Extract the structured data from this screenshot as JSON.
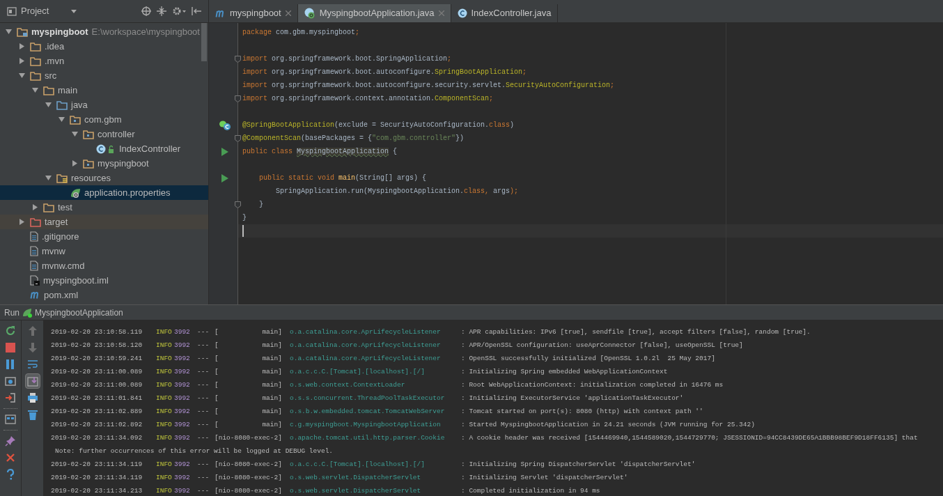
{
  "project_panel": {
    "title": "Project",
    "tree": [
      {
        "label": "myspingboot",
        "path": "E:\\workspace\\myspingboot",
        "kind": "module",
        "expanded": true,
        "selected": false,
        "children": [
          {
            "label": ".idea",
            "kind": "folder",
            "expanded": false,
            "selected": false
          },
          {
            "label": ".mvn",
            "kind": "folder",
            "expanded": false,
            "selected": false
          },
          {
            "label": "src",
            "kind": "folder",
            "expanded": true,
            "selected": false,
            "children": [
              {
                "label": "main",
                "kind": "folder",
                "expanded": true,
                "selected": false,
                "children": [
                  {
                    "label": "java",
                    "kind": "source-folder",
                    "expanded": true,
                    "selected": false,
                    "children": [
                      {
                        "label": "com.gbm",
                        "kind": "package",
                        "expanded": true,
                        "selected": false,
                        "children": [
                          {
                            "label": "controller",
                            "kind": "package",
                            "expanded": true,
                            "selected": false,
                            "children": [
                              {
                                "label": "IndexController",
                                "kind": "class",
                                "selected": false
                              }
                            ]
                          },
                          {
                            "label": "myspingboot",
                            "kind": "package",
                            "expanded": false,
                            "selected": false
                          }
                        ]
                      }
                    ]
                  },
                  {
                    "label": "resources",
                    "kind": "resources",
                    "expanded": true,
                    "selected": false,
                    "children": [
                      {
                        "label": "application.properties",
                        "kind": "spring-file",
                        "selected": true
                      }
                    ]
                  }
                ]
              },
              {
                "label": "test",
                "kind": "folder",
                "expanded": false,
                "selected": false
              }
            ]
          },
          {
            "label": "target",
            "kind": "excluded-folder",
            "expanded": false,
            "selected": false
          },
          {
            "label": ".gitignore",
            "kind": "file",
            "selected": false
          },
          {
            "label": "mvnw",
            "kind": "file",
            "selected": false
          },
          {
            "label": "mvnw.cmd",
            "kind": "file",
            "selected": false
          },
          {
            "label": "myspingboot.iml",
            "kind": "iml",
            "selected": false
          },
          {
            "label": "pom.xml",
            "kind": "maven",
            "selected": false
          }
        ]
      }
    ]
  },
  "tabs": [
    {
      "label": "myspingboot",
      "kind": "maven",
      "selected": false,
      "closable": true
    },
    {
      "label": "MyspingbootApplication.java",
      "kind": "spring",
      "selected": true,
      "closable": true
    },
    {
      "label": "IndexController.java",
      "kind": "class",
      "selected": false,
      "closable": false
    }
  ],
  "editor": {
    "lines": [
      {
        "kind": "plain",
        "tokens": [
          {
            "text": "package ",
            "kind": "keyword"
          },
          {
            "text": "com.gbm.myspingboot",
            "kind": "plain"
          },
          {
            "text": ";",
            "kind": "keyword"
          }
        ]
      },
      {
        "kind": "plain"
      },
      {
        "kind": "fold",
        "tokens": [
          {
            "text": "import ",
            "kind": "keyword"
          },
          {
            "text": "org.springframework.boot.SpringApplication",
            "kind": "plain"
          },
          {
            "text": ";",
            "kind": "keyword"
          }
        ]
      },
      {
        "kind": "plain",
        "tokens": [
          {
            "text": "import ",
            "kind": "keyword"
          },
          {
            "text": "org.springframework.boot.autoconfigure.",
            "kind": "plain"
          },
          {
            "text": "SpringBootApplication",
            "kind": "annotation"
          },
          {
            "text": ";",
            "kind": "keyword"
          }
        ]
      },
      {
        "kind": "plain",
        "tokens": [
          {
            "text": "import ",
            "kind": "keyword"
          },
          {
            "text": "org.springframework.boot.autoconfigure.security.servlet.",
            "kind": "plain"
          },
          {
            "text": "SecurityAutoConfiguration",
            "kind": "annotation"
          },
          {
            "text": ";",
            "kind": "keyword"
          }
        ]
      },
      {
        "kind": "fold",
        "tokens": [
          {
            "text": "import ",
            "kind": "keyword"
          },
          {
            "text": "org.springframework.context.annotation.",
            "kind": "plain"
          },
          {
            "text": "ComponentScan",
            "kind": "annotation"
          },
          {
            "text": ";",
            "kind": "keyword"
          }
        ]
      },
      {
        "kind": "plain"
      },
      {
        "kind": "bean",
        "tokens": [
          {
            "text": "@SpringBootApplication",
            "kind": "annotation"
          },
          {
            "text": "(exclude = SecurityAutoConfiguration.",
            "kind": "plain"
          },
          {
            "text": "class",
            "kind": "keyword"
          },
          {
            "text": ")",
            "kind": "plain"
          }
        ]
      },
      {
        "kind": "fold",
        "tokens": [
          {
            "text": "@ComponentScan",
            "kind": "annotation"
          },
          {
            "text": "(basePackages = {",
            "kind": "plain"
          },
          {
            "text": "\"com.gbm.controller\"",
            "kind": "string"
          },
          {
            "text": "})",
            "kind": "plain"
          }
        ]
      },
      {
        "kind": "run",
        "tokens": [
          {
            "text": "public class ",
            "kind": "keyword"
          },
          {
            "text": "MyspingbootApplication",
            "kind": "highlight"
          },
          {
            "text": " {",
            "kind": "plain"
          }
        ]
      },
      {
        "kind": "plain"
      },
      {
        "kind": "run",
        "tokens": [
          {
            "text": "    public static void ",
            "kind": "keyword"
          },
          {
            "text": "main",
            "kind": "method"
          },
          {
            "text": "(String[] args) {",
            "kind": "plain"
          }
        ]
      },
      {
        "kind": "plain",
        "tokens": [
          {
            "text": "        SpringApplication.run(MyspingbootApplication.",
            "kind": "plain"
          },
          {
            "text": "class, ",
            "kind": "keyword"
          },
          {
            "text": "args",
            "kind": "plain"
          },
          {
            "text": ");",
            "kind": "keyword"
          }
        ]
      },
      {
        "kind": "fold",
        "tokens": [
          {
            "text": "    }",
            "kind": "plain"
          }
        ]
      },
      {
        "kind": "plain",
        "tokens": [
          {
            "text": "}",
            "kind": "plain"
          }
        ]
      },
      {
        "kind": "caret"
      }
    ]
  },
  "run_panel": {
    "label": "Run",
    "config": "MyspingbootApplication",
    "lines": [
      {
        "kind": "log",
        "time": "2019-02-20 23:10:58.119",
        "level": "INFO",
        "pid": "3992",
        "sep": "---",
        "thread": "[           main]",
        "logger": "o.a.catalina.core.AprLifecycleListener",
        "message": ": APR capabilities: IPv6 [true], sendfile [true], accept filters [false], random [true]."
      },
      {
        "kind": "log",
        "time": "2019-02-20 23:10:58.120",
        "level": "INFO",
        "pid": "3992",
        "sep": "---",
        "thread": "[           main]",
        "logger": "o.a.catalina.core.AprLifecycleListener",
        "message": ": APR/OpenSSL configuration: useAprConnector [false], useOpenSSL [true]"
      },
      {
        "kind": "log",
        "time": "2019-02-20 23:10:59.241",
        "level": "INFO",
        "pid": "3992",
        "sep": "---",
        "thread": "[           main]",
        "logger": "o.a.catalina.core.AprLifecycleListener",
        "message": ": OpenSSL successfully initialized [OpenSSL 1.0.2l  25 May 2017]"
      },
      {
        "kind": "log",
        "time": "2019-02-20 23:11:00.089",
        "level": "INFO",
        "pid": "3992",
        "sep": "---",
        "thread": "[           main]",
        "logger": "o.a.c.c.C.[Tomcat].[localhost].[/]",
        "message": ": Initializing Spring embedded WebApplicationContext"
      },
      {
        "kind": "log",
        "time": "2019-02-20 23:11:00.089",
        "level": "INFO",
        "pid": "3992",
        "sep": "---",
        "thread": "[           main]",
        "logger": "o.s.web.context.ContextLoader",
        "message": ": Root WebApplicationContext: initialization completed in 16476 ms"
      },
      {
        "kind": "log",
        "time": "2019-02-20 23:11:01.841",
        "level": "INFO",
        "pid": "3992",
        "sep": "---",
        "thread": "[           main]",
        "logger": "o.s.s.concurrent.ThreadPoolTaskExecutor",
        "message": ": Initializing ExecutorService 'applicationTaskExecutor'"
      },
      {
        "kind": "log",
        "time": "2019-02-20 23:11:02.889",
        "level": "INFO",
        "pid": "3992",
        "sep": "---",
        "thread": "[           main]",
        "logger": "o.s.b.w.embedded.tomcat.TomcatWebServer",
        "message": ": Tomcat started on port(s): 8080 (http) with context path ''"
      },
      {
        "kind": "log",
        "time": "2019-02-20 23:11:02.892",
        "level": "INFO",
        "pid": "3992",
        "sep": "---",
        "thread": "[           main]",
        "logger": "c.g.myspingboot.MyspingbootApplication",
        "message": ": Started MyspingbootApplication in 24.21 seconds (JVM running for 25.342)"
      },
      {
        "kind": "log",
        "time": "2019-02-20 23:11:34.092",
        "level": "INFO",
        "pid": "3992",
        "sep": "---",
        "thread": "[nio-8080-exec-2]",
        "logger": "o.apache.tomcat.util.http.parser.Cookie",
        "message": ": A cookie header was received [1544469940,1544589020,1544729770; JSESSIONID=94CC8439DE65A1BBB98BEF9D18FF6135] that"
      },
      {
        "kind": "note",
        "text": "Note: further occurrences of this error will be logged at DEBUG level."
      },
      {
        "kind": "log",
        "time": "2019-02-20 23:11:34.119",
        "level": "INFO",
        "pid": "3992",
        "sep": "---",
        "thread": "[nio-8080-exec-2]",
        "logger": "o.a.c.c.C.[Tomcat].[localhost].[/]",
        "message": ": Initializing Spring DispatcherServlet 'dispatcherServlet'"
      },
      {
        "kind": "log",
        "time": "2019-02-20 23:11:34.119",
        "level": "INFO",
        "pid": "3992",
        "sep": "---",
        "thread": "[nio-8080-exec-2]",
        "logger": "o.s.web.servlet.DispatcherServlet",
        "message": ": Initializing Servlet 'dispatcherServlet'"
      },
      {
        "kind": "log",
        "time": "2019-02-20 23:11:34.213",
        "level": "INFO",
        "pid": "3992",
        "sep": "---",
        "thread": "[nio-8080-exec-2]",
        "logger": "o.s.web.servlet.DispatcherServlet",
        "message": ": Completed initialization in 94 ms"
      }
    ],
    "scroll_to_end": {
      "selected": true
    }
  }
}
